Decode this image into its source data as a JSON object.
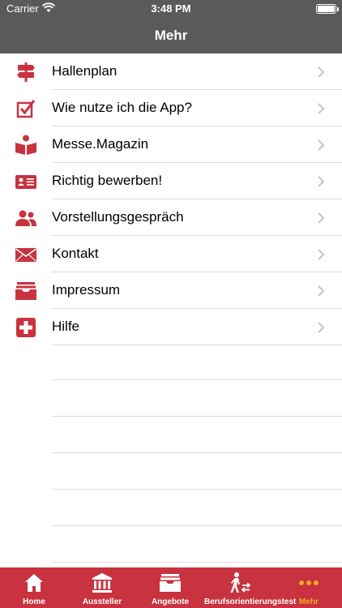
{
  "status_bar": {
    "carrier": "Carrier",
    "time": "3:48 PM"
  },
  "nav": {
    "title": "Mehr"
  },
  "colors": {
    "accent": "#c8333f",
    "header": "#5a5a5a",
    "active_tab": "#f5a623"
  },
  "menu": {
    "items": [
      {
        "label": "Hallenplan",
        "icon": "signpost-icon"
      },
      {
        "label": "Wie nutze ich die App?",
        "icon": "checkbox-icon"
      },
      {
        "label": "Messe.Magazin",
        "icon": "reader-book-icon"
      },
      {
        "label": "Richtig bewerben!",
        "icon": "id-card-icon"
      },
      {
        "label": "Vorstellungsgespräch",
        "icon": "people-icon"
      },
      {
        "label": "Kontakt",
        "icon": "envelope-icon"
      },
      {
        "label": "Impressum",
        "icon": "archive-box-icon"
      },
      {
        "label": "Hilfe",
        "icon": "plus-cross-icon"
      }
    ]
  },
  "tabs": [
    {
      "label": "Home",
      "icon": "house-icon"
    },
    {
      "label": "Aussteller",
      "icon": "bank-building-icon"
    },
    {
      "label": "Angebote",
      "icon": "inbox-tray-icon"
    },
    {
      "label": "Berufsorientierungstest",
      "icon": "person-arrows-icon"
    },
    {
      "label": "Mehr",
      "icon": "more-dots-icon",
      "active": true
    }
  ]
}
